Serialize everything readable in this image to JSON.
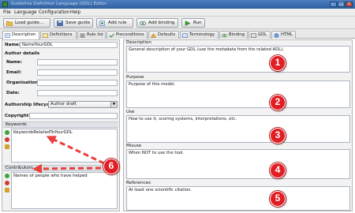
{
  "window": {
    "title": "Guideline Definition Language (GDL) Editor"
  },
  "menu": [
    "File",
    "Language",
    "Configuration",
    "Help"
  ],
  "toolbar": {
    "load_label": "Load guide...",
    "save_label": "Save guide",
    "add_rule_label": "Add rule",
    "add_binding_label": "Add binding",
    "run_label": "Run"
  },
  "tabs": [
    "Description",
    "Definitions",
    "Rule list",
    "Preconditions",
    "Defaults",
    "Terminology",
    "Binding",
    "GDL",
    "HTML"
  ],
  "left": {
    "name_label": "Name:",
    "name_value": "NameYourGDL",
    "author_details": "Author details",
    "author_name_label": "Name:",
    "email_label": "Email:",
    "organisation_label": "Organisation:",
    "date_label": "Date:",
    "lifecycle_label": "Authorship lifecycle:",
    "lifecycle_value": "Author draft",
    "copyright_label": "Copyright:",
    "keywords_header": "Keywords",
    "keywords_item": "KeywordsRelatedToYourGDL",
    "contributors_header": "Contributors",
    "contributors_item": "Names of people who have helped"
  },
  "right": {
    "description_title": "Description",
    "description_text": "General description of your GDL (use the metadata from the related ADL).",
    "purpose_title": "Purpose",
    "purpose_text": "Purpose of this model.",
    "use_title": "Use",
    "use_text": "How to use it, scoring systems, interpretations, etc.",
    "misuse_title": "Misuse",
    "misuse_text": "When NOT to use the tool.",
    "references_title": "References",
    "references_text": "At least one scientific citation."
  },
  "annotations": [
    "1",
    "2",
    "3",
    "4",
    "5",
    "6"
  ],
  "colors": {
    "badge": "#e21d23",
    "arrow": "#e8403c",
    "titlebar": "#3a6aac"
  }
}
